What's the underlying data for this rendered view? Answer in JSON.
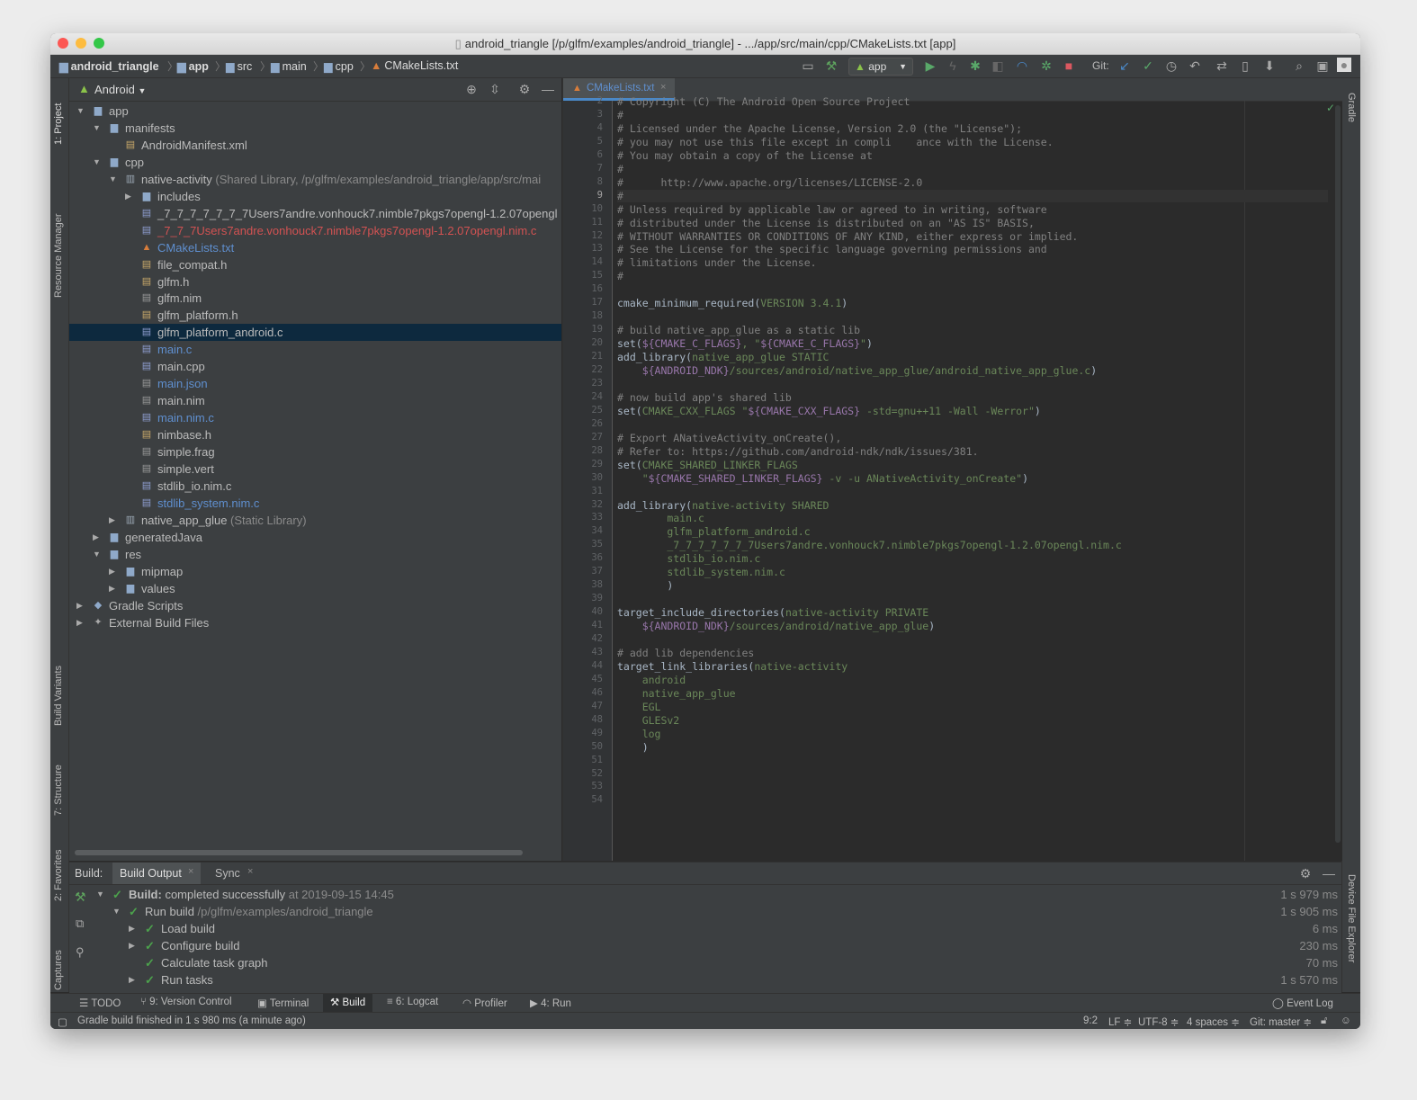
{
  "title_bar": {
    "title": "android_triangle [/p/glfm/examples/android_triangle] - .../app/src/main/cpp/CMakeLists.txt [app]"
  },
  "breadcrumbs": [
    "android_triangle",
    "app",
    "src",
    "main",
    "cpp",
    "CMakeLists.txt"
  ],
  "toolbar": {
    "run_config": "app",
    "git_label": "Git:"
  },
  "left_strip": {
    "project": "1: Project",
    "resource_manager": "Resource Manager",
    "build_variants": "Build Variants",
    "structure": "7: Structure",
    "favorites": "2: Favorites",
    "layout_captures": "Layout Captures"
  },
  "right_strip": {
    "gradle": "Gradle",
    "device_file_explorer": "Device File Explorer"
  },
  "project_panel": {
    "view_mode": "Android",
    "tree": [
      {
        "label": "app",
        "level": 0,
        "expanded": true,
        "icon": "module-folder-icon"
      },
      {
        "label": "manifests",
        "level": 1,
        "expanded": true,
        "icon": "folder-icon"
      },
      {
        "label": "AndroidManifest.xml",
        "level": 2,
        "icon": "xml-file-icon"
      },
      {
        "label": "cpp",
        "level": 1,
        "expanded": true,
        "icon": "folder-icon"
      },
      {
        "label": "native-activity",
        "suffix": " (Shared Library, /p/glfm/examples/android_triangle/app/src/mai",
        "level": 2,
        "expanded": true,
        "icon": "library-icon"
      },
      {
        "label": "includes",
        "level": 3,
        "expanded": false,
        "icon": "folder-icon"
      },
      {
        "label": "_7_7_7_7_7_7_7Users7andre.vonhouck7.nimble7pkgs7opengl-1.2.07opengl",
        "level": 3,
        "icon": "c-file-icon"
      },
      {
        "label": "_7_7_7Users7andre.vonhouck7.nimble7pkgs7opengl-1.2.07opengl.nim.c",
        "level": 3,
        "icon": "c-file-icon",
        "color": "#d25252"
      },
      {
        "label": "CMakeLists.txt",
        "level": 3,
        "icon": "cmake-icon",
        "color": "#5f8fcf"
      },
      {
        "label": "file_compat.h",
        "level": 3,
        "icon": "h-file-icon"
      },
      {
        "label": "glfm.h",
        "level": 3,
        "icon": "h-file-icon"
      },
      {
        "label": "glfm.nim",
        "level": 3,
        "icon": "text-file-icon"
      },
      {
        "label": "glfm_platform.h",
        "level": 3,
        "icon": "h-file-icon"
      },
      {
        "label": "glfm_platform_android.c",
        "level": 3,
        "icon": "c-file-icon",
        "selected": true
      },
      {
        "label": "main.c",
        "level": 3,
        "icon": "c-file-icon",
        "color": "#5f8fcf"
      },
      {
        "label": "main.cpp",
        "level": 3,
        "icon": "cpp-file-icon"
      },
      {
        "label": "main.json",
        "level": 3,
        "icon": "json-file-icon",
        "color": "#5f8fcf"
      },
      {
        "label": "main.nim",
        "level": 3,
        "icon": "text-file-icon"
      },
      {
        "label": "main.nim.c",
        "level": 3,
        "icon": "c-file-icon",
        "color": "#5f8fcf"
      },
      {
        "label": "nimbase.h",
        "level": 3,
        "icon": "h-file-icon"
      },
      {
        "label": "simple.frag",
        "level": 3,
        "icon": "text-file-icon"
      },
      {
        "label": "simple.vert",
        "level": 3,
        "icon": "text-file-icon"
      },
      {
        "label": "stdlib_io.nim.c",
        "level": 3,
        "icon": "c-file-icon"
      },
      {
        "label": "stdlib_system.nim.c",
        "level": 3,
        "icon": "c-file-icon",
        "color": "#5f8fcf"
      },
      {
        "label": "native_app_glue",
        "suffix": " (Static Library)",
        "level": 2,
        "expanded": false,
        "icon": "library-icon"
      },
      {
        "label": "generatedJava",
        "level": 1,
        "expanded": false,
        "icon": "generated-folder-icon"
      },
      {
        "label": "res",
        "level": 1,
        "expanded": true,
        "icon": "res-folder-icon"
      },
      {
        "label": "mipmap",
        "level": 2,
        "expanded": false,
        "icon": "folder-icon"
      },
      {
        "label": "values",
        "level": 2,
        "expanded": false,
        "icon": "folder-icon"
      },
      {
        "label": "Gradle Scripts",
        "level": 0,
        "expanded": false,
        "icon": "gradle-icon"
      },
      {
        "label": "External Build Files",
        "level": 0,
        "expanded": false,
        "icon": "tools-icon"
      }
    ]
  },
  "editor": {
    "tab_label": "CMakeLists.txt",
    "current_line": "9",
    "lines": [
      {
        "n": "2",
        "segs": [
          [
            "c",
            "# Copyright (C) The Android Open Source Project"
          ]
        ]
      },
      {
        "n": "3",
        "segs": [
          [
            "c",
            "#"
          ]
        ]
      },
      {
        "n": "4",
        "segs": [
          [
            "c",
            "# Licensed under the Apache License, Version 2.0 (the \"License\");"
          ]
        ]
      },
      {
        "n": "5",
        "segs": [
          [
            "c",
            "# you may not use this file except in compli    ance with the License."
          ]
        ]
      },
      {
        "n": "6",
        "segs": [
          [
            "c",
            "# You may obtain a copy of the License at"
          ]
        ]
      },
      {
        "n": "7",
        "segs": [
          [
            "c",
            "#"
          ]
        ]
      },
      {
        "n": "8",
        "segs": [
          [
            "c",
            "#      http://www.apache.org/licenses/LICENSE-2.0"
          ]
        ]
      },
      {
        "n": "9",
        "segs": [
          [
            "c",
            "#"
          ]
        ]
      },
      {
        "n": "10",
        "segs": [
          [
            "c",
            "# Unless required by applicable law or agreed to in writing, software"
          ]
        ]
      },
      {
        "n": "11",
        "segs": [
          [
            "c",
            "# distributed under the License is distributed on an \"AS IS\" BASIS,"
          ]
        ]
      },
      {
        "n": "12",
        "segs": [
          [
            "c",
            "# WITHOUT WARRANTIES OR CONDITIONS OF ANY KIND, either express or implied."
          ]
        ]
      },
      {
        "n": "13",
        "segs": [
          [
            "c",
            "# See the License for the specific language governing permissions and"
          ]
        ]
      },
      {
        "n": "14",
        "segs": [
          [
            "c",
            "# limitations under the License."
          ]
        ]
      },
      {
        "n": "15",
        "segs": [
          [
            "c",
            "#"
          ]
        ]
      },
      {
        "n": "16",
        "segs": []
      },
      {
        "n": "17",
        "segs": [
          [
            "f",
            "cmake_minimum_required("
          ],
          [
            "a",
            "VERSION 3.4.1"
          ],
          [
            "f",
            ")"
          ]
        ]
      },
      {
        "n": "18",
        "segs": []
      },
      {
        "n": "19",
        "segs": [
          [
            "c",
            "# build native_app_glue as a static lib"
          ]
        ]
      },
      {
        "n": "20",
        "segs": [
          [
            "f",
            "set("
          ],
          [
            "v",
            "${CMAKE_C_FLAGS}"
          ],
          [
            "a",
            ", \""
          ],
          [
            "v",
            "${CMAKE_C_FLAGS}"
          ],
          [
            "a",
            "\""
          ],
          [
            "f",
            ")"
          ]
        ]
      },
      {
        "n": "21",
        "segs": [
          [
            "f",
            "add_library("
          ],
          [
            "a",
            "native_app_glue STATIC"
          ]
        ]
      },
      {
        "n": "22",
        "segs": [
          [
            "a",
            "    "
          ],
          [
            "v",
            "${ANDROID_NDK}"
          ],
          [
            "a",
            "/sources/android/native_app_glue/android_native_app_glue.c"
          ],
          [
            "f",
            ")"
          ]
        ]
      },
      {
        "n": "23",
        "segs": []
      },
      {
        "n": "24",
        "segs": [
          [
            "c",
            "# now build app's shared lib"
          ]
        ]
      },
      {
        "n": "25",
        "segs": [
          [
            "f",
            "set("
          ],
          [
            "a",
            "CMAKE_CXX_FLAGS \""
          ],
          [
            "v",
            "${CMAKE_CXX_FLAGS}"
          ],
          [
            "a",
            " -std=gnu++11 -Wall -Werror\""
          ],
          [
            "f",
            ")"
          ]
        ]
      },
      {
        "n": "26",
        "segs": []
      },
      {
        "n": "27",
        "segs": [
          [
            "c",
            "# Export ANativeActivity_onCreate(),"
          ]
        ]
      },
      {
        "n": "28",
        "segs": [
          [
            "c",
            "# Refer to: https://github.com/android-ndk/ndk/issues/381."
          ]
        ]
      },
      {
        "n": "29",
        "segs": [
          [
            "f",
            "set("
          ],
          [
            "a",
            "CMAKE_SHARED_LINKER_FLAGS"
          ]
        ]
      },
      {
        "n": "30",
        "segs": [
          [
            "a",
            "    \""
          ],
          [
            "v",
            "${CMAKE_SHARED_LINKER_FLAGS}"
          ],
          [
            "a",
            " -v -u ANativeActivity_onCreate\""
          ],
          [
            "f",
            ")"
          ]
        ]
      },
      {
        "n": "31",
        "segs": []
      },
      {
        "n": "32",
        "segs": [
          [
            "f",
            "add_library("
          ],
          [
            "a",
            "native-activity SHARED"
          ]
        ]
      },
      {
        "n": "33",
        "segs": [
          [
            "a",
            "        main.c"
          ]
        ]
      },
      {
        "n": "34",
        "segs": [
          [
            "a",
            "        glfm_platform_android.c"
          ]
        ]
      },
      {
        "n": "35",
        "segs": [
          [
            "a",
            "        _7_7_7_7_7_7_7Users7andre.vonhouck7.nimble7pkgs7opengl-1.2.07opengl.nim.c"
          ]
        ]
      },
      {
        "n": "36",
        "segs": [
          [
            "a",
            "        stdlib_io.nim.c"
          ]
        ]
      },
      {
        "n": "37",
        "segs": [
          [
            "a",
            "        stdlib_system.nim.c"
          ]
        ]
      },
      {
        "n": "38",
        "segs": [
          [
            "f",
            "        )"
          ]
        ]
      },
      {
        "n": "39",
        "segs": []
      },
      {
        "n": "40",
        "segs": [
          [
            "f",
            "target_include_directories("
          ],
          [
            "a",
            "native-activity PRIVATE"
          ]
        ]
      },
      {
        "n": "41",
        "segs": [
          [
            "a",
            "    "
          ],
          [
            "v",
            "${ANDROID_NDK}"
          ],
          [
            "a",
            "/sources/android/native_app_glue"
          ],
          [
            "f",
            ")"
          ]
        ]
      },
      {
        "n": "42",
        "segs": []
      },
      {
        "n": "43",
        "segs": [
          [
            "c",
            "# add lib dependencies"
          ]
        ]
      },
      {
        "n": "44",
        "segs": [
          [
            "f",
            "target_link_libraries("
          ],
          [
            "a",
            "native-activity"
          ]
        ]
      },
      {
        "n": "45",
        "segs": [
          [
            "a",
            "    android"
          ]
        ]
      },
      {
        "n": "46",
        "segs": [
          [
            "a",
            "    native_app_glue"
          ]
        ]
      },
      {
        "n": "47",
        "segs": [
          [
            "a",
            "    EGL"
          ]
        ]
      },
      {
        "n": "48",
        "segs": [
          [
            "a",
            "    GLESv2"
          ]
        ]
      },
      {
        "n": "49",
        "segs": [
          [
            "a",
            "    log"
          ]
        ]
      },
      {
        "n": "50",
        "segs": [
          [
            "f",
            "    )"
          ]
        ]
      },
      {
        "n": "51",
        "segs": []
      },
      {
        "n": "52",
        "segs": []
      },
      {
        "n": "53",
        "segs": []
      },
      {
        "n": "54",
        "segs": []
      }
    ]
  },
  "build_panel": {
    "label": "Build:",
    "tabs": [
      "Build Output",
      "Sync"
    ],
    "rows": [
      {
        "level": 0,
        "arrow": "down",
        "bold": "Build:",
        "text": " completed successfully",
        "dim": " at 2019-09-15 14:45",
        "time": "1 s 979 ms"
      },
      {
        "level": 1,
        "arrow": "down",
        "text": "Run build",
        "dim": " /p/glfm/examples/android_triangle",
        "time": "1 s 905 ms"
      },
      {
        "level": 2,
        "arrow": "right",
        "text": "Load build",
        "dim": "",
        "time": "6 ms"
      },
      {
        "level": 2,
        "arrow": "right",
        "text": "Configure build",
        "dim": "",
        "time": "230 ms"
      },
      {
        "level": 2,
        "arrow": "none",
        "text": "Calculate task graph",
        "dim": "",
        "time": "70 ms"
      },
      {
        "level": 2,
        "arrow": "right",
        "text": "Run tasks",
        "dim": "",
        "time": "1 s 570 ms"
      }
    ]
  },
  "tool_windows": {
    "todo": "TODO",
    "version_control": "9: Version Control",
    "terminal": "Terminal",
    "build": "Build",
    "logcat": "6: Logcat",
    "profiler": "Profiler",
    "run": "4: Run",
    "event_log": "Event Log"
  },
  "status_bar": {
    "message": "Gradle build finished in 1 s 980 ms (a minute ago)",
    "position": "9:2",
    "line_sep": "LF ≑",
    "encoding": "UTF-8 ≑",
    "indent": "4 spaces ≑",
    "git_branch": "Git: master ≑"
  },
  "colors": {
    "accent": "#4a88c7",
    "selection": "#0d293e",
    "success": "#4ca34c",
    "error_text": "#d25252"
  }
}
